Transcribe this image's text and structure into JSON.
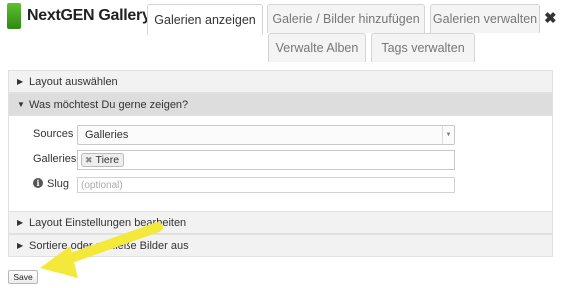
{
  "header": {
    "logo_text": "NextGEN Gallery",
    "tabs": [
      {
        "label": "Galerien anzeigen",
        "active": true
      },
      {
        "label": "Galerie / Bilder hinzufügen",
        "active": false
      },
      {
        "label": "Galerien verwalten",
        "active": false
      },
      {
        "label": "Verwalte Alben",
        "active": false
      },
      {
        "label": "Tags verwalten",
        "active": false
      }
    ],
    "close_icon": "✖"
  },
  "sections": [
    {
      "label": "Layout auswählen",
      "open": false
    },
    {
      "label": "Was möchtest Du gerne zeigen?",
      "open": true
    },
    {
      "label": "Layout Einstellungen bearbeiten",
      "open": false
    },
    {
      "label": "Sortiere oder schließe Bilder aus",
      "open": false
    }
  ],
  "form": {
    "sources_label": "Sources",
    "sources_value": "Galleries",
    "galleries_label": "Galleries",
    "gallery_chips": [
      "Tiere"
    ],
    "slug_label": "Slug",
    "slug_placeholder": "(optional)"
  },
  "save_label": "Save",
  "colors": {
    "annotation_arrow": "#f4e83a",
    "logo_green": "#3aa31a"
  }
}
